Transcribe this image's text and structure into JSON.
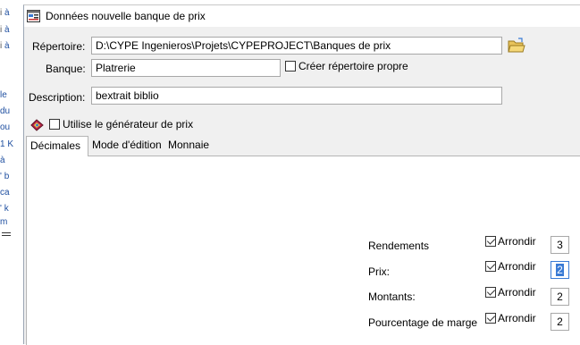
{
  "background_doc": {
    "lines": [
      {
        "a": "à",
        "b": "i"
      },
      {
        "a": "à",
        "b": "i"
      },
      {
        "a": "à",
        "b": "i"
      },
      {
        "a": "le",
        "b": ""
      },
      {
        "a": "du",
        "b": ""
      },
      {
        "a": "ou",
        "b": ""
      },
      {
        "a": "1 K",
        "b": ""
      },
      {
        "a": "à",
        "b": ""
      },
      {
        "a": "' b",
        "b": ""
      },
      {
        "a": "ca",
        "b": ""
      },
      {
        "a": "' k",
        "b": ""
      },
      {
        "a": "m",
        "b": ""
      }
    ]
  },
  "dialog": {
    "title": "Données nouvelle banque de prix"
  },
  "form": {
    "repertoire_label": "Répertoire:",
    "repertoire_value": "D:\\CYPE Ingenieros\\Projets\\CYPEPROJECT\\Banques de prix",
    "banque_label": "Banque:",
    "banque_value": "Platrerie",
    "creer_label": "Créer répertoire propre",
    "creer_checked": false,
    "description_label": "Description:",
    "description_value": "bextrait biblio",
    "utilise_label": "Utilise le générateur de prix",
    "utilise_checked": false
  },
  "tabs": [
    {
      "label": "Décimales",
      "active": true
    },
    {
      "label": "Mode d'édition",
      "active": false
    },
    {
      "label": "Monnaie",
      "active": false
    }
  ],
  "decimals": {
    "rows": [
      {
        "label": "Rendements",
        "arrondir": "Arrondir",
        "checked": true,
        "value": "3",
        "focused": false
      },
      {
        "label": "Prix:",
        "arrondir": "Arrondir",
        "checked": true,
        "value": "2",
        "focused": true
      },
      {
        "label": "Montants:",
        "arrondir": "Arrondir",
        "checked": true,
        "value": "2",
        "focused": false
      },
      {
        "label": "Pourcentage de marge",
        "arrondir": "Arrondir",
        "checked": true,
        "value": "2",
        "focused": false
      }
    ]
  },
  "icons": {
    "title": "dialog-app-icon",
    "folder": "folder-open-icon",
    "generator": "price-generator-icon"
  }
}
